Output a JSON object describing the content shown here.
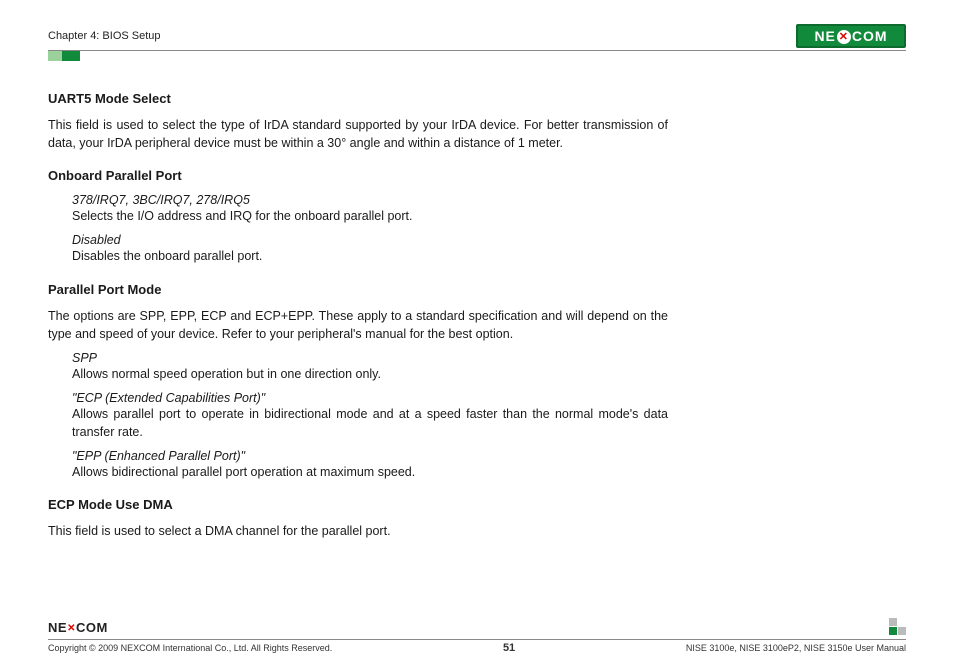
{
  "header": {
    "chapter": "Chapter 4: BIOS Setup",
    "logo_text": "NE COM",
    "logo_x": "X"
  },
  "sections": {
    "uart5": {
      "title": "UART5 Mode Select",
      "para": "This field is used to select the type of IrDA standard supported by your IrDA device. For better transmission of data, your IrDA peripheral device must be within a 30° angle and within a distance of 1 meter."
    },
    "onboard": {
      "title": "Onboard Parallel Port",
      "opt1_label": "378/IRQ7, 3BC/IRQ7, 278/IRQ5",
      "opt1_desc": "Selects the I/O address and IRQ for the onboard parallel port.",
      "opt2_label": "Disabled",
      "opt2_desc": "Disables the onboard parallel port."
    },
    "ppm": {
      "title": "Parallel Port Mode",
      "intro": "The options are SPP, EPP, ECP and ECP+EPP. These apply to a standard specification and will depend on the type and speed of your device. Refer to your peripheral's manual for the best option.",
      "spp_label": "SPP",
      "spp_desc": "Allows normal speed operation but in one direction only.",
      "ecp_label": "\"ECP (Extended Capabilities Port)\"",
      "ecp_desc": "Allows parallel port to operate in bidirectional mode and at a speed faster than the normal mode's data transfer rate.",
      "epp_label": "\"EPP (Enhanced Parallel Port)\"",
      "epp_desc": "Allows bidirectional parallel port operation at maximum speed."
    },
    "ecpdma": {
      "title": "ECP Mode Use DMA",
      "para": "This field is used to select a DMA channel for the parallel port."
    }
  },
  "footer": {
    "logo": "NE COM",
    "logo_x": "X",
    "copyright": "Copyright © 2009 NEXCOM International Co., Ltd. All Rights Reserved.",
    "page": "51",
    "manual": "NISE 3100e, NISE 3100eP2, NISE 3150e User Manual"
  }
}
